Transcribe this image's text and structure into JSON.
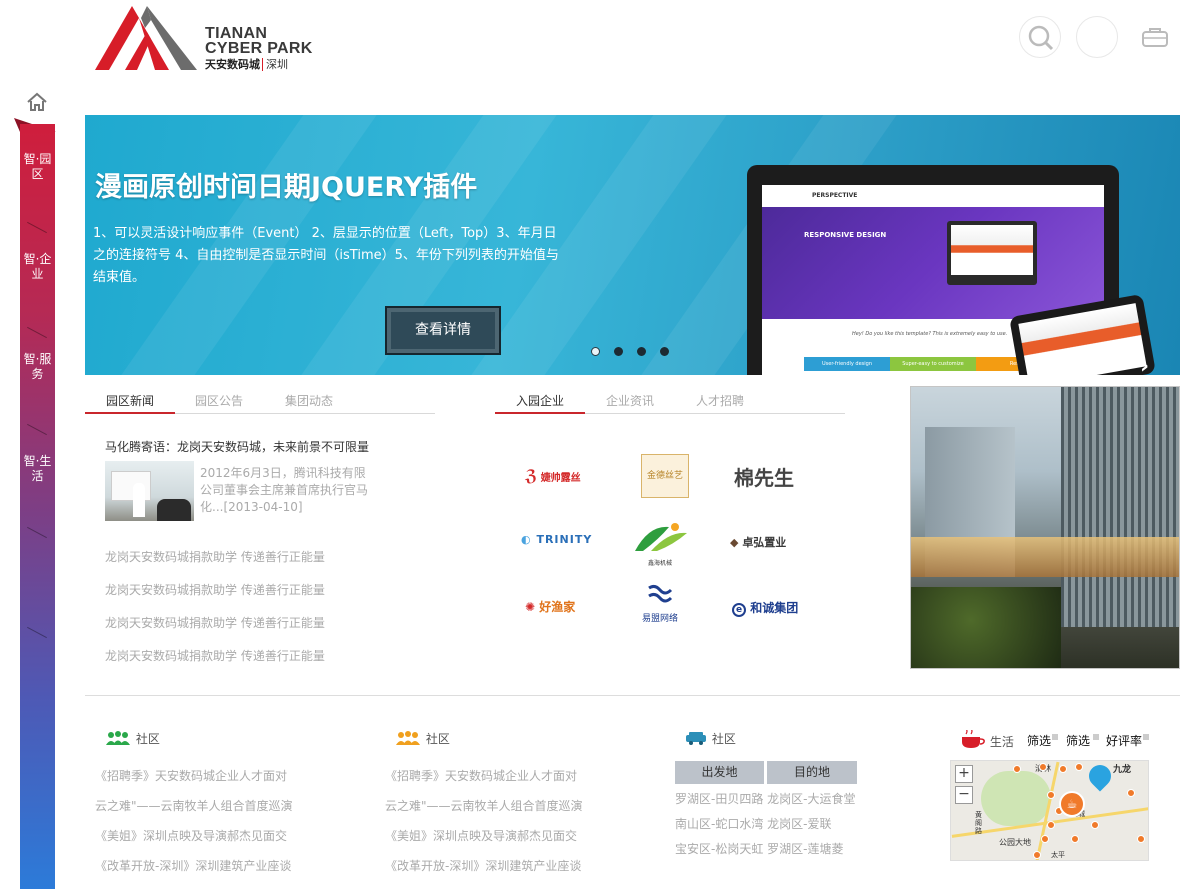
{
  "brand": {
    "name_en_line1": "TIANAN",
    "name_en_line2": "CYBER PARK",
    "name_cn": "天安数码城",
    "city": "深圳"
  },
  "header": {
    "icons": [
      "search-icon",
      "user-icon",
      "bag-icon"
    ]
  },
  "sidebar": {
    "home_icon": "home-icon",
    "items": [
      {
        "label": "智·园区"
      },
      {
        "label": "智·企业"
      },
      {
        "label": "智·服务"
      },
      {
        "label": "智·生活"
      }
    ]
  },
  "banner": {
    "title": "漫画原创时间日期JQUERY插件",
    "description": "1、可以灵活设计响应事件（Event） 2、层显示的位置（Left，Top）3、年月日之的连接符号 4、自由控制是否显示时间（isTime）5、年份下列列表的开始值与结束值。",
    "button_label": "查看详情",
    "slides": 4,
    "active_slide": 1,
    "mockup": {
      "brand": "PERSPECTIVE",
      "headline": "RESPONSIVE DESIGN",
      "tagline": "Hey! Do you like this template? This is extremely easy to use.",
      "features": [
        "User-friendly design",
        "Super-easy to customize",
        "Respon"
      ]
    }
  },
  "news": {
    "tabs": [
      "园区新闻",
      "园区公告",
      "集团动态"
    ],
    "active_tab": 0,
    "headline": "马化腾寄语：龙岗天安数码城，未来前景不可限量",
    "summary": "2012年6月3日，腾讯科技有限公司董事会主席兼首席执行官马化...[2013-04-10]",
    "links": [
      "龙岗天安数码城捐款助学 传递善行正能量",
      "龙岗天安数码城捐款助学 传递善行正能量",
      "龙岗天安数码城捐款助学 传递善行正能量",
      "龙岗天安数码城捐款助学 传递善行正能量"
    ]
  },
  "enterprises": {
    "tabs": [
      "入园企业",
      "企业资讯",
      "人才招聘"
    ],
    "active_tab": 0,
    "logos": [
      "婕帅露丝",
      "金德丝艺",
      "棉先生",
      "TRINITY",
      "鑫海机械",
      "卓弘置业",
      "好渔家",
      "易盟网络",
      "和诚集团"
    ]
  },
  "community": {
    "col1": {
      "title": "社区",
      "links": [
        "《招聘季》天安数码城企业人才面对",
        "云之难\"——云南牧羊人组合首度巡演",
        "《美姐》深圳点映及导演郝杰见面交",
        "《改革开放-深圳》深圳建筑产业座谈"
      ]
    },
    "col2": {
      "title": "社区",
      "links": [
        "《招聘季》天安数码城企业人才面对",
        "云之难\"——云南牧羊人组合首度巡演",
        "《美姐》深圳点映及导演郝杰见面交",
        "《改革开放-深圳》深圳建筑产业座谈"
      ]
    }
  },
  "transport": {
    "title": "社区",
    "headers": [
      "出发地",
      "目的地"
    ],
    "routes": [
      "罗湖区-田贝四路 龙岗区-大运食堂",
      "南山区-蛇口水湾 龙岗区-爱联",
      "宝安区-松岗天虹 罗湖区-莲塘菱"
    ]
  },
  "life": {
    "title": "生活",
    "filters": [
      "筛选",
      "筛选",
      "好评率"
    ],
    "map_labels": [
      "清林",
      "公园大地",
      "黄阁路",
      "龙城",
      "太平",
      "九龙"
    ]
  },
  "colors": {
    "accent": "#c9262c",
    "sidebar_top": "#cf1e3c",
    "sidebar_bottom": "#2c7bd9",
    "banner": "#2faed4"
  }
}
